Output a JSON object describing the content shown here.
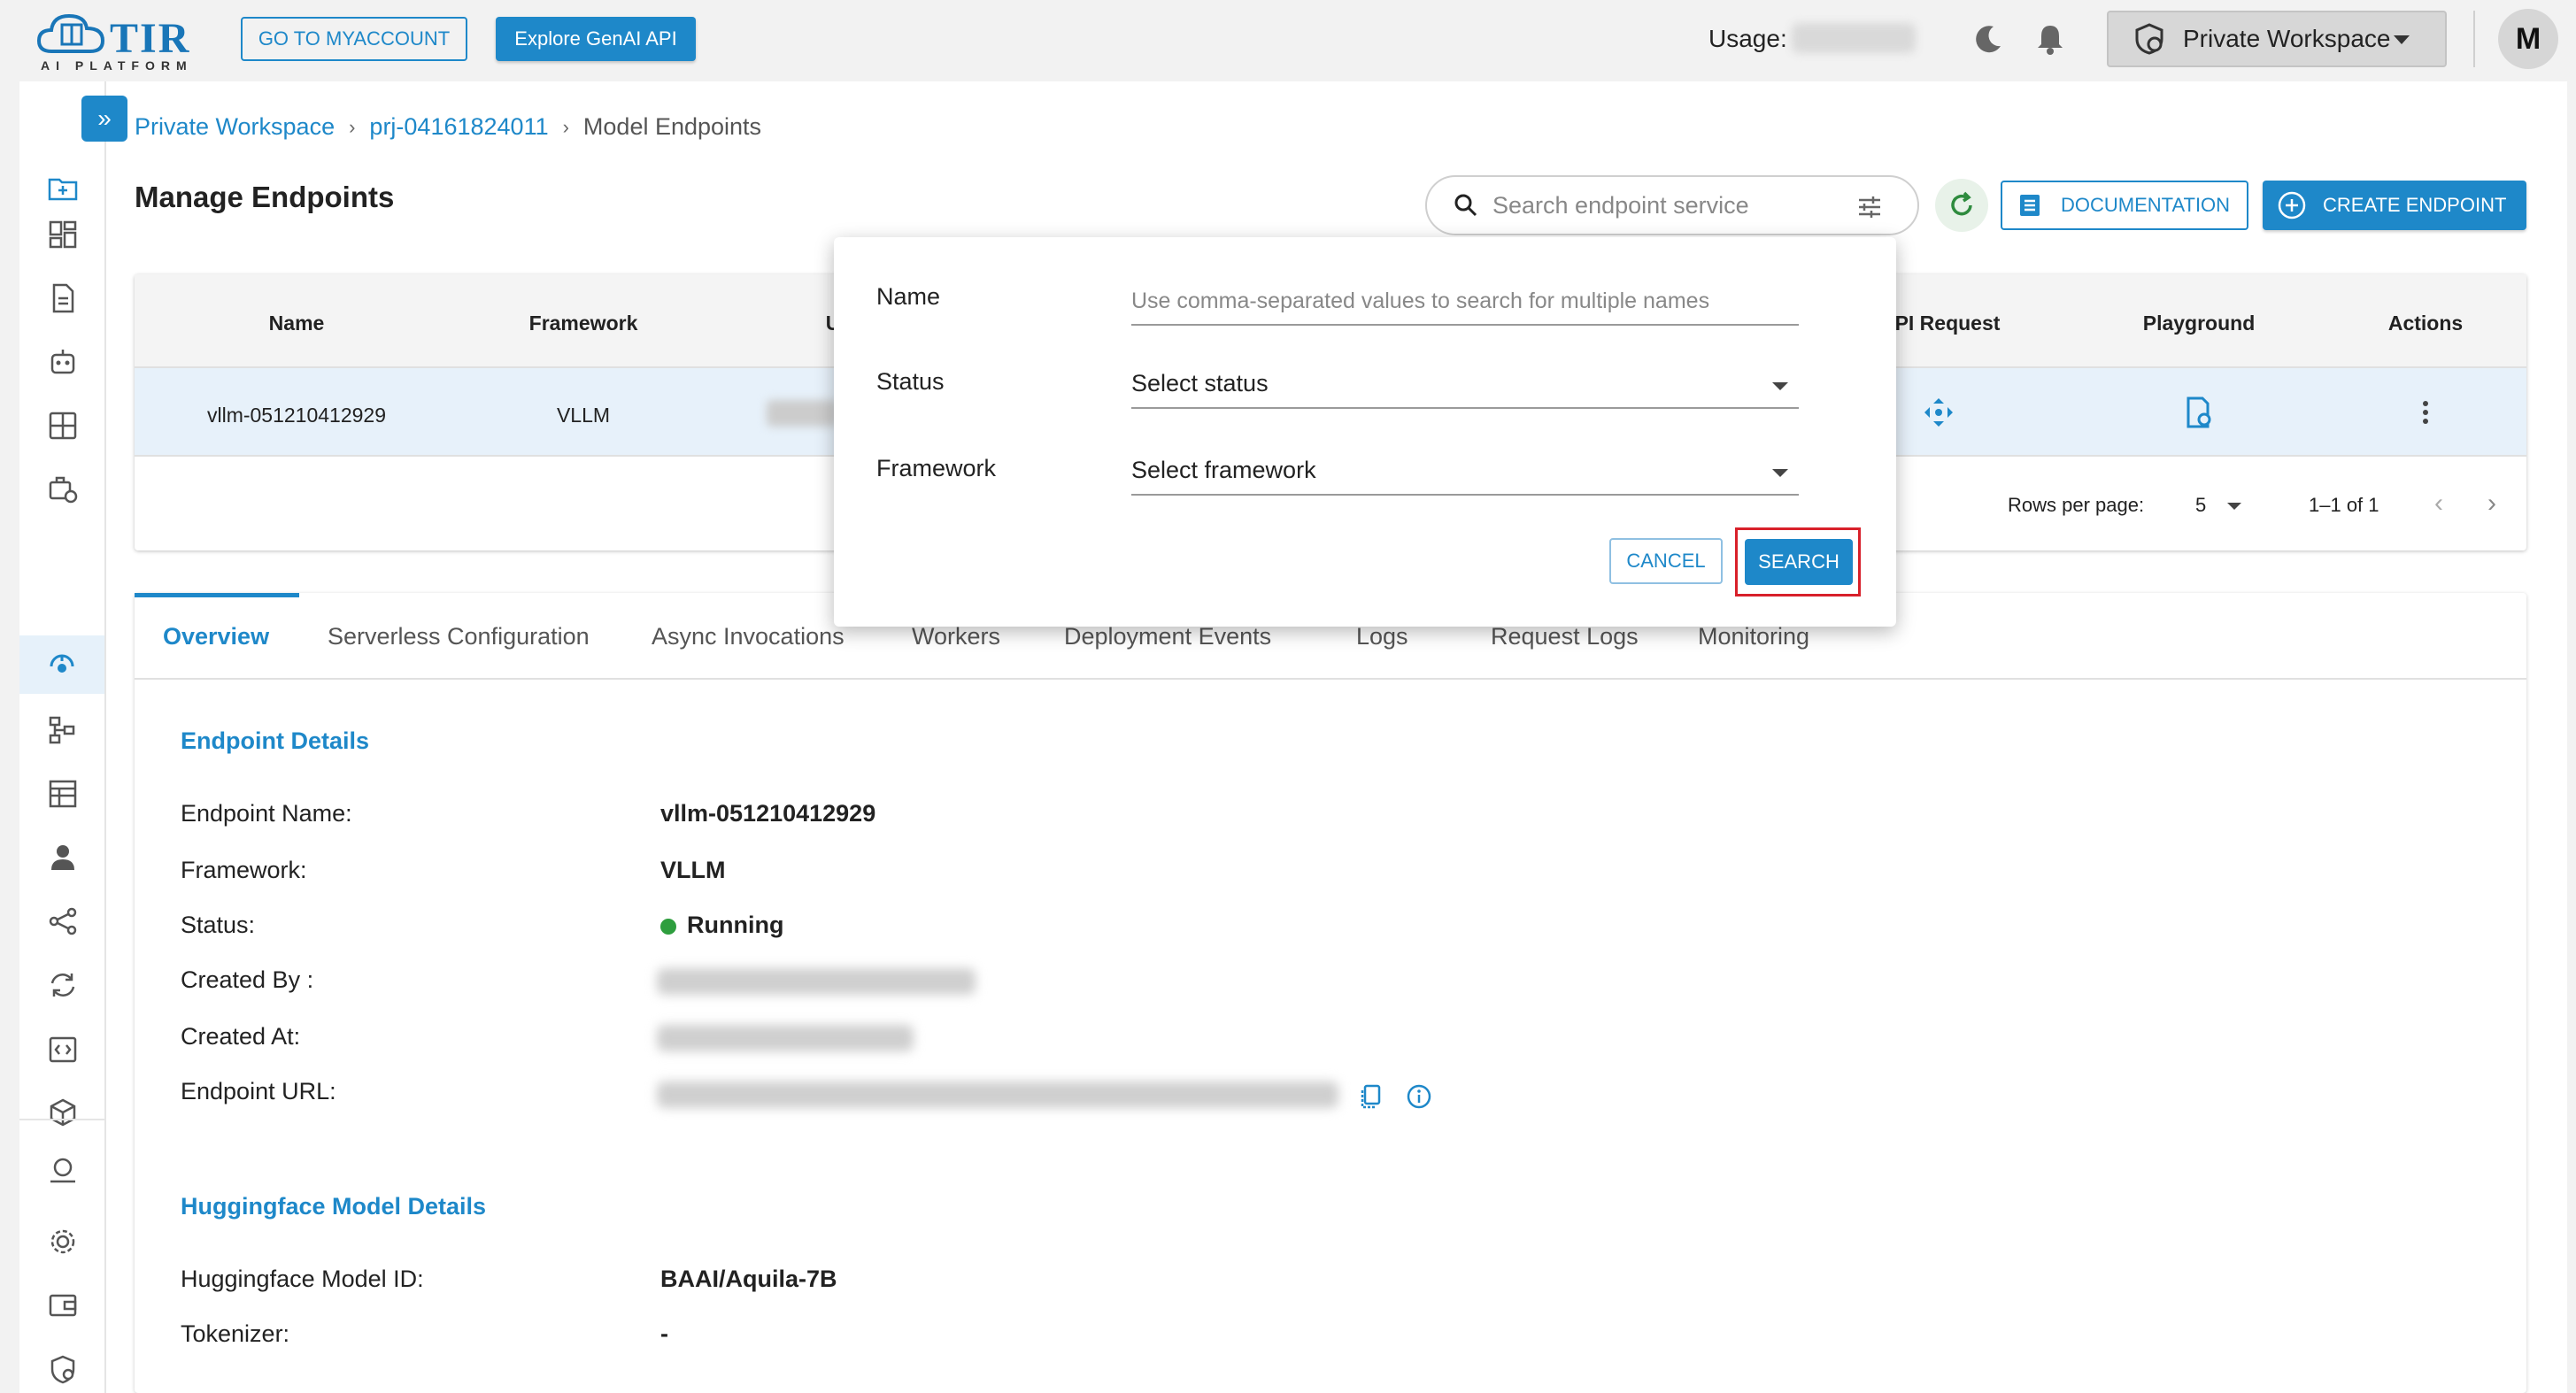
{
  "header": {
    "logo_text": "TIR",
    "logo_sub": "AI PLATFORM",
    "myaccount_label": "GO TO MYACCOUNT",
    "genai_label": "Explore GenAI API",
    "usage_label": "Usage:",
    "workspace_label": "Private Workspace",
    "avatar_initial": "M"
  },
  "breadcrumb": {
    "items": [
      "Private Workspace",
      "prj-04161824011",
      "Model Endpoints"
    ],
    "separator": "›"
  },
  "page": {
    "title": "Manage Endpoints",
    "search_placeholder": "Search endpoint service",
    "documentation_label": "DOCUMENTATION",
    "create_label": "CREATE ENDPOINT"
  },
  "table": {
    "columns": [
      "Name",
      "Framework",
      "U",
      "PI Request",
      "Playground",
      "Actions"
    ],
    "rows": [
      {
        "name": "vllm-051210412929",
        "framework": "VLLM"
      }
    ],
    "rows_per_page_label": "Rows per page:",
    "rows_per_page": "5",
    "range": "1–1 of 1"
  },
  "tabs": [
    "Overview",
    "Serverless Configuration",
    "Async Invocations",
    "Workers",
    "Deployment Events",
    "Logs",
    "Request Logs",
    "Monitoring"
  ],
  "endpoint_details": {
    "title": "Endpoint Details",
    "name_label": "Endpoint Name:",
    "name_value": "vllm-051210412929",
    "framework_label": "Framework:",
    "framework_value": "VLLM",
    "status_label": "Status:",
    "status_value": "Running",
    "created_by_label": "Created By :",
    "created_at_label": "Created At:",
    "url_label": "Endpoint URL:"
  },
  "hf_details": {
    "title": "Huggingface Model Details",
    "model_id_label": "Huggingface Model ID:",
    "model_id_value": "BAAI/Aquila-7B",
    "tokenizer_label": "Tokenizer:",
    "tokenizer_value": "-"
  },
  "filter_popover": {
    "name_label": "Name",
    "name_placeholder": "Use comma-separated values to search for multiple names",
    "status_label": "Status",
    "status_value": "Select status",
    "framework_label": "Framework",
    "framework_value": "Select framework",
    "cancel_label": "CANCEL",
    "search_label": "SEARCH"
  },
  "colors": {
    "accent": "#1e88c9",
    "highlight": "#d8202a",
    "status_running": "#2e9e3e"
  }
}
